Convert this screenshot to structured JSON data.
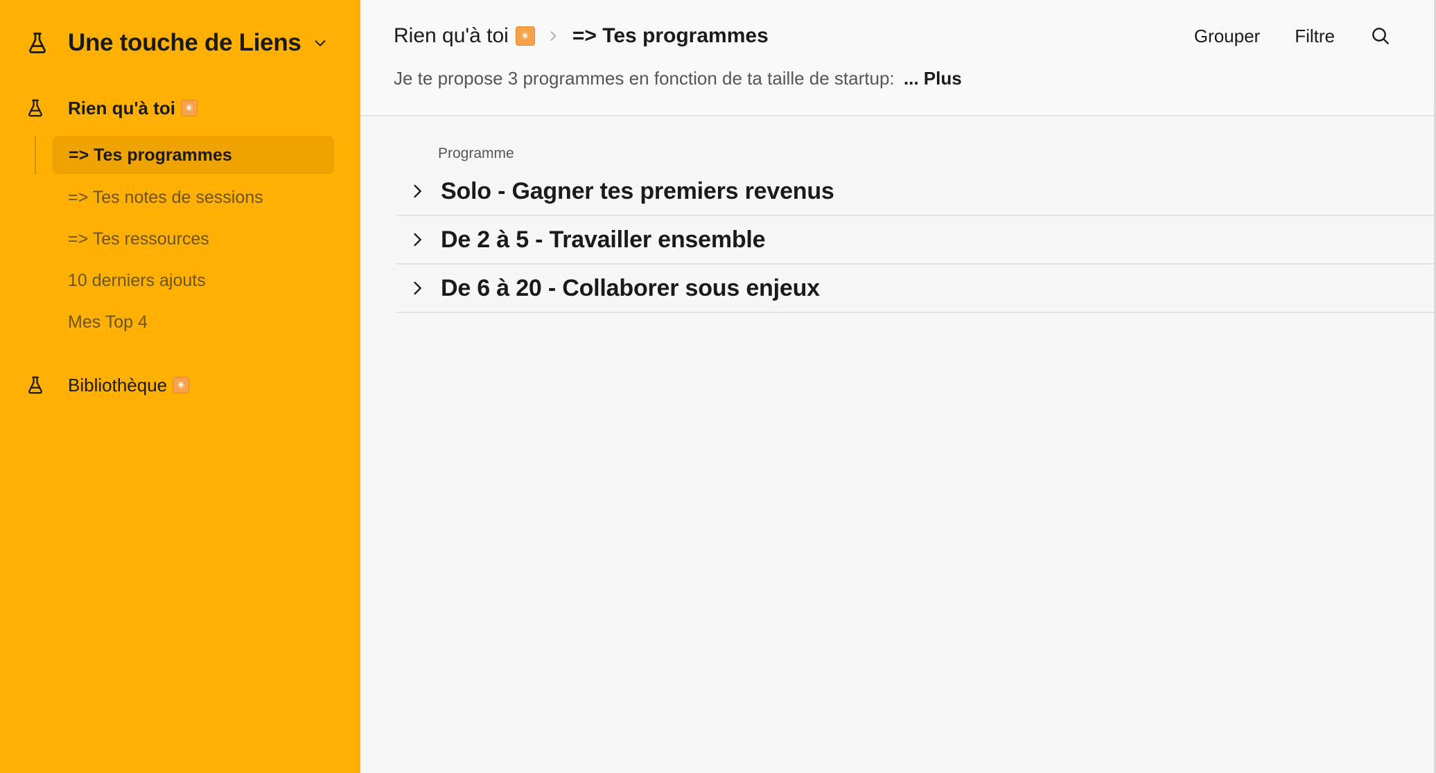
{
  "workspace": {
    "title": "Une touche de Liens"
  },
  "sidebar": {
    "sections": [
      {
        "label": "Rien qu'à toi",
        "emoji": "✴",
        "items": [
          {
            "label": "=> Tes programmes",
            "active": true
          },
          {
            "label": "=> Tes notes de sessions",
            "active": false
          },
          {
            "label": "=> Tes ressources",
            "active": false
          },
          {
            "label": "10 derniers ajouts",
            "active": false
          },
          {
            "label": "Mes Top 4",
            "active": false
          }
        ]
      },
      {
        "label": "Bibliothèque",
        "emoji": "✴",
        "items": []
      }
    ]
  },
  "header": {
    "breadcrumb": {
      "parent": "Rien qu'à toi",
      "parent_emoji": "✴",
      "current": "=> Tes programmes"
    },
    "actions": {
      "group": "Grouper",
      "filter": "Filtre"
    },
    "description": "Je te propose 3 programmes en fonction de ta taille de startup:",
    "more": "... Plus"
  },
  "table": {
    "column_header": "Programme",
    "groups": [
      {
        "title": "Solo - Gagner tes premiers revenus"
      },
      {
        "title": "De 2 à 5 - Travailler ensemble"
      },
      {
        "title": "De 6 à 20 - Collaborer sous enjeux"
      }
    ]
  },
  "colors": {
    "sidebar_bg": "#FFB000",
    "active_item_bg": "#EFA300",
    "spark": "#F7A24A"
  }
}
